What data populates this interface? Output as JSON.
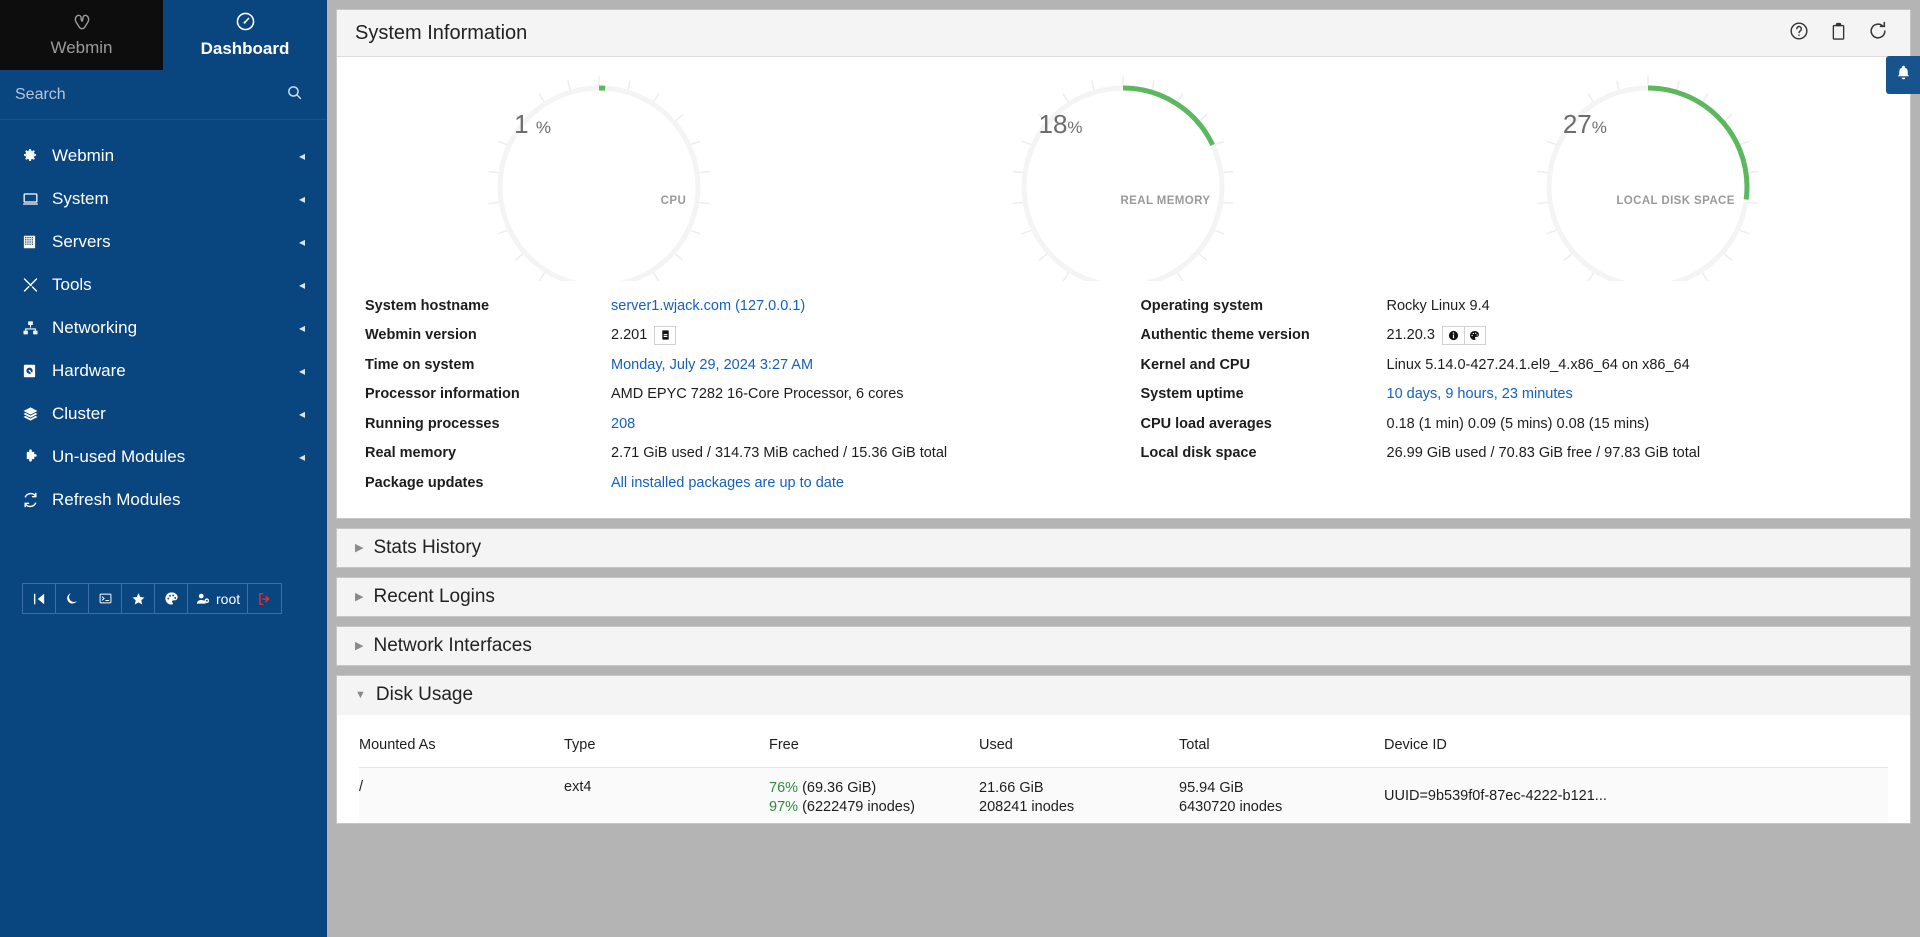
{
  "sidebar": {
    "brand": {
      "label": "Webmin",
      "icon": "webmin-logo-icon"
    },
    "dashboard": {
      "label": "Dashboard",
      "icon": "dashboard-gauge-icon"
    },
    "search": {
      "placeholder": "Search",
      "value": "",
      "icon": "search-icon"
    },
    "items": [
      {
        "label": "Webmin",
        "icon": "gear-icon",
        "caret": "◂"
      },
      {
        "label": "System",
        "icon": "monitor-icon",
        "caret": "◂"
      },
      {
        "label": "Servers",
        "icon": "server-rack-icon",
        "caret": "◂"
      },
      {
        "label": "Tools",
        "icon": "tools-icon",
        "caret": "◂"
      },
      {
        "label": "Networking",
        "icon": "network-icon",
        "caret": "◂"
      },
      {
        "label": "Hardware",
        "icon": "harddisk-icon",
        "caret": "◂"
      },
      {
        "label": "Cluster",
        "icon": "layers-icon",
        "caret": "◂"
      },
      {
        "label": "Un-used Modules",
        "icon": "puzzle-icon",
        "caret": "◂"
      },
      {
        "label": "Refresh Modules",
        "icon": "refresh-icon",
        "caret": ""
      }
    ],
    "tools": [
      {
        "name": "collapse-sidebar-button",
        "glyph": "❘◀",
        "label": ""
      },
      {
        "name": "dark-mode-button",
        "glyph": "☾",
        "label": ""
      },
      {
        "name": "terminal-button",
        "glyph": "⌨",
        "label": ""
      },
      {
        "name": "favorites-button",
        "glyph": "★",
        "label": ""
      },
      {
        "name": "theme-palette-button",
        "glyph": "◕",
        "label": ""
      },
      {
        "name": "user-account-button",
        "glyph": "⚯",
        "label": "root"
      },
      {
        "name": "logout-button",
        "glyph": "→",
        "label": ""
      }
    ]
  },
  "panel": {
    "title": "System Information",
    "head_icons": [
      {
        "name": "help-icon",
        "glyph": "?"
      },
      {
        "name": "clipboard-icon",
        "glyph": "⌸"
      },
      {
        "name": "refresh-icon",
        "glyph": "↻"
      }
    ]
  },
  "notification": {
    "icon": "bell-icon",
    "glyph": "ὑ4"
  },
  "gauges": [
    {
      "label": "CPU",
      "percent": 1,
      "value_text": "1",
      "symbol": "%",
      "color": "#5cb85c"
    },
    {
      "label": "REAL MEMORY",
      "percent": 18,
      "value_text": "18",
      "symbol": "%",
      "color": "#5cb85c"
    },
    {
      "label": "LOCAL DISK SPACE",
      "percent": 27,
      "value_text": "27",
      "symbol": "%",
      "color": "#5cb85c"
    }
  ],
  "info_left": [
    {
      "key": "System hostname",
      "value": "server1.wjack.com (127.0.0.1)",
      "link": true,
      "badges": []
    },
    {
      "key": "Webmin version",
      "value": "2.201",
      "link": false,
      "badges": [
        {
          "name": "changelog-icon",
          "glyph": "▤"
        }
      ]
    },
    {
      "key": "Time on system",
      "value": "Monday, July 29, 2024 3:27 AM",
      "link": true,
      "badges": []
    },
    {
      "key": "Processor information",
      "value": "AMD EPYC 7282 16-Core Processor, 6 cores",
      "link": false,
      "badges": []
    },
    {
      "key": "Running processes",
      "value": "208",
      "link": true,
      "badges": []
    },
    {
      "key": "Real memory",
      "value": "2.71 GiB used / 314.73 MiB cached / 15.36 GiB total",
      "link": false,
      "badges": []
    },
    {
      "key": "Package updates",
      "value": "All installed packages are up to date",
      "link": true,
      "badges": []
    }
  ],
  "info_right": [
    {
      "key": "Operating system",
      "value": "Rocky Linux 9.4",
      "link": false,
      "badges": []
    },
    {
      "key": "Authentic theme version",
      "value": "21.20.3",
      "link": false,
      "badges": [
        {
          "name": "info-icon",
          "glyph": "ℹ"
        },
        {
          "name": "palette-icon",
          "glyph": "◕"
        }
      ]
    },
    {
      "key": "Kernel and CPU",
      "value": "Linux 5.14.0-427.24.1.el9_4.x86_64 on x86_64",
      "link": false,
      "badges": []
    },
    {
      "key": "System uptime",
      "value": "10 days, 9 hours, 23 minutes",
      "link": true,
      "badges": []
    },
    {
      "key": "CPU load averages",
      "value": "0.18 (1 min) 0.09 (5 mins) 0.08 (15 mins)",
      "link": false,
      "badges": []
    },
    {
      "key": "Local disk space",
      "value": "26.99 GiB used / 70.83 GiB free / 97.83 GiB total",
      "link": false,
      "badges": []
    }
  ],
  "sections": [
    {
      "label": "Stats History",
      "expanded": false,
      "tri": "▶"
    },
    {
      "label": "Recent Logins",
      "expanded": false,
      "tri": "▶"
    },
    {
      "label": "Network Interfaces",
      "expanded": false,
      "tri": "▶"
    },
    {
      "label": "Disk Usage",
      "expanded": true,
      "tri": "▼"
    }
  ],
  "disk_table": {
    "columns": [
      "Mounted As",
      "Type",
      "Free",
      "Used",
      "Total",
      "Device ID"
    ],
    "rows": [
      {
        "mounted_as": "/",
        "type": "ext4",
        "free_pct": "76%",
        "free_size": "(69.36 GiB)",
        "free_inode_pct": "97%",
        "free_inodes": "(6222479 inodes)",
        "used_size": "21.66 GiB",
        "used_inodes": "208241 inodes",
        "total_size": "95.94 GiB",
        "total_inodes": "6430720 inodes",
        "device_id": "UUID=9b539f0f-87ec-4222-b121..."
      }
    ]
  }
}
